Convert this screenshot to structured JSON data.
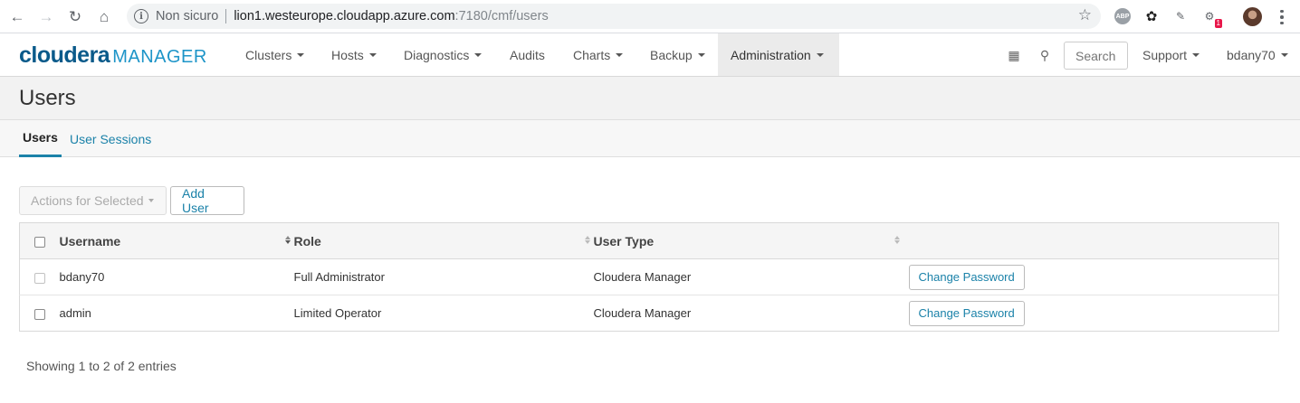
{
  "browser": {
    "security_label": "Non sicuro",
    "url_host": "lion1.westeurope.cloudapp.azure.com",
    "url_path": ":7180/cmf/users",
    "extension_badge": "1",
    "abp_label": "ABP"
  },
  "app": {
    "logo_text": "cloudera",
    "logo_suffix": "MANAGER"
  },
  "nav": {
    "items": [
      {
        "label": "Clusters"
      },
      {
        "label": "Hosts"
      },
      {
        "label": "Diagnostics"
      },
      {
        "label": "Audits"
      },
      {
        "label": "Charts"
      },
      {
        "label": "Backup"
      },
      {
        "label": "Administration"
      }
    ],
    "search_placeholder": "Search",
    "support_label": "Support",
    "user_label": "bdany70"
  },
  "page": {
    "title": "Users",
    "tabs": [
      {
        "label": "Users",
        "active": true
      },
      {
        "label": "User Sessions",
        "active": false
      }
    ]
  },
  "toolbar": {
    "actions_label": "Actions for Selected",
    "add_user_label": "Add User"
  },
  "table": {
    "columns": [
      "Username",
      "Role",
      "User Type"
    ],
    "rows": [
      {
        "username": "bdany70",
        "role": "Full Administrator",
        "user_type": "Cloudera Manager",
        "action": "Change Password"
      },
      {
        "username": "admin",
        "role": "Limited Operator",
        "user_type": "Cloudera Manager",
        "action": "Change Password"
      }
    ],
    "footer": "Showing 1 to 2 of 2 entries"
  },
  "colors": {
    "accent": "#1b82a9",
    "logo": "#0a5a8a"
  }
}
